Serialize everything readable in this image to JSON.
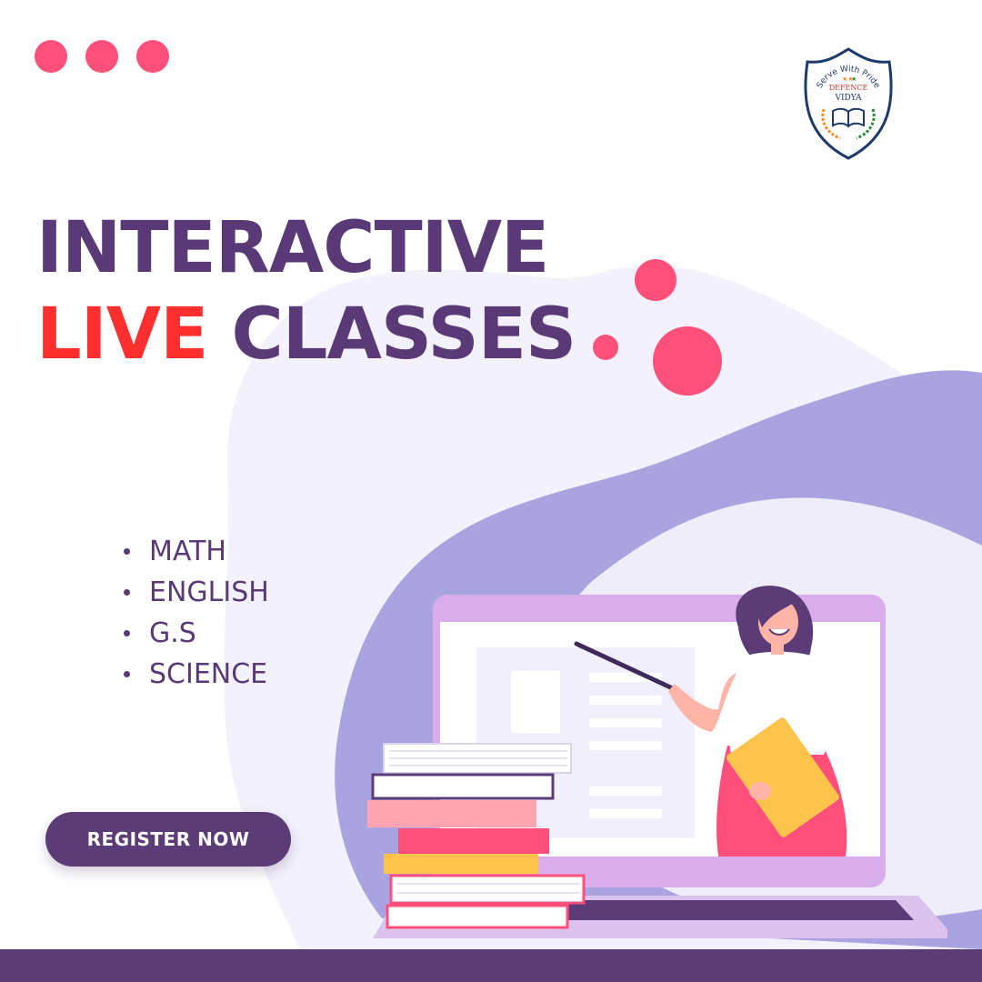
{
  "brand_colors": {
    "purple": "#5a3a76",
    "red": "#ff2f2f",
    "pink": "#ff4f7b",
    "lavender": "#a8a2df",
    "light_lavender": "#f1effb"
  },
  "window_dots": [
    "pink-dot",
    "pink-dot",
    "pink-dot"
  ],
  "logo": {
    "arc_text": "Serve With Pride",
    "name_line1": "DEFENCE",
    "name_line2": "VIDYA",
    "icon": "open-book-icon"
  },
  "headline": {
    "line1": "INTERACTIVE",
    "live": "LIVE",
    "classes": "CLASSES"
  },
  "subjects": [
    "MATH",
    "ENGLISH",
    "G.S",
    "SCIENCE"
  ],
  "cta": {
    "label": "REGISTER NOW"
  },
  "illustration": {
    "description_icon": "teacher-laptop-illustration"
  }
}
